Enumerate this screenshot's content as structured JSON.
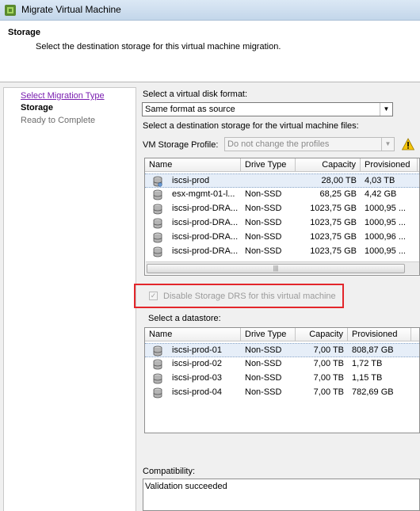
{
  "window": {
    "title": "Migrate Virtual Machine"
  },
  "header": {
    "title": "Storage",
    "description": "Select the destination storage for this virtual machine migration."
  },
  "steps": [
    {
      "label": "Select Migration Type"
    },
    {
      "label": "Storage"
    },
    {
      "label": "Ready to Complete"
    }
  ],
  "disk_format": {
    "label": "Select a virtual disk format:",
    "value": "Same format as source"
  },
  "destination_label": "Select a destination storage for the virtual machine files:",
  "storage_profile": {
    "label": "VM Storage Profile:",
    "value": "Do not change the profiles"
  },
  "cluster_table": {
    "columns": [
      "Name",
      "Drive Type",
      "Capacity",
      "Provisioned"
    ],
    "rows": [
      {
        "name": "iscsi-prod",
        "drive": "",
        "capacity": "28,00 TB",
        "provisioned": "4,03 TB"
      },
      {
        "name": "esx-mgmt-01-l...",
        "drive": "Non-SSD",
        "capacity": "68,25 GB",
        "provisioned": "4,42 GB"
      },
      {
        "name": "iscsi-prod-DRA...",
        "drive": "Non-SSD",
        "capacity": "1023,75 GB",
        "provisioned": "1000,95 ..."
      },
      {
        "name": "iscsi-prod-DRA...",
        "drive": "Non-SSD",
        "capacity": "1023,75 GB",
        "provisioned": "1000,95 ..."
      },
      {
        "name": "iscsi-prod-DRA...",
        "drive": "Non-SSD",
        "capacity": "1023,75 GB",
        "provisioned": "1000,96 ..."
      },
      {
        "name": "iscsi-prod-DRA...",
        "drive": "Non-SSD",
        "capacity": "1023,75 GB",
        "provisioned": "1000,95 ..."
      }
    ]
  },
  "drs_checkbox": {
    "label": "Disable Storage DRS for this virtual machine",
    "checked": true
  },
  "datastore_label": "Select a datastore:",
  "datastore_table": {
    "columns": [
      "Name",
      "Drive Type",
      "Capacity",
      "Provisioned"
    ],
    "rows": [
      {
        "name": "iscsi-prod-01",
        "drive": "Non-SSD",
        "capacity": "7,00 TB",
        "provisioned": "808,87 GB"
      },
      {
        "name": "iscsi-prod-02",
        "drive": "Non-SSD",
        "capacity": "7,00 TB",
        "provisioned": "1,72 TB"
      },
      {
        "name": "iscsi-prod-03",
        "drive": "Non-SSD",
        "capacity": "7,00 TB",
        "provisioned": "1,15 TB"
      },
      {
        "name": "iscsi-prod-04",
        "drive": "Non-SSD",
        "capacity": "7,00 TB",
        "provisioned": "782,69 GB"
      }
    ]
  },
  "compatibility": {
    "label": "Compatibility:",
    "value": "Validation succeeded"
  },
  "colors": {
    "accent_red": "#e3262b",
    "link": "#7a1fb0"
  },
  "icons": [
    "vsphere-app-icon",
    "warning-icon",
    "datastore-cluster-icon",
    "datastore-icon"
  ]
}
